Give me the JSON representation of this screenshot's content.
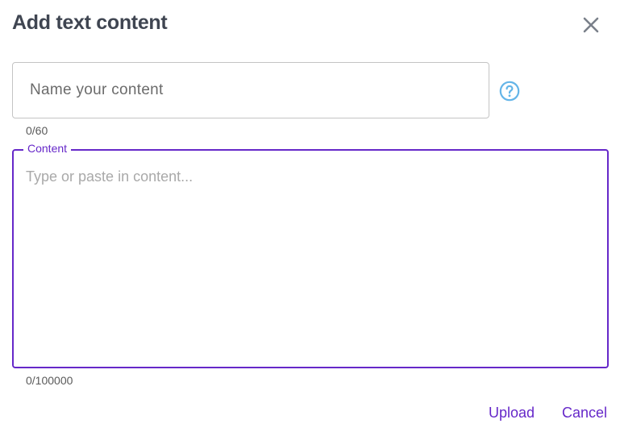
{
  "dialog": {
    "title": "Add text content",
    "close_icon": "close-icon",
    "help_icon": "help-circle-icon"
  },
  "name_field": {
    "value": "",
    "placeholder": "Name your content",
    "counter": "0/60"
  },
  "content_field": {
    "label": "Content",
    "value": "",
    "placeholder": "Type or paste in content...",
    "counter": "0/100000"
  },
  "actions": {
    "upload_label": "Upload",
    "cancel_label": "Cancel"
  },
  "colors": {
    "accent": "#6628c9",
    "title": "#3f4551",
    "help": "#64b5e8",
    "close": "#7a808a"
  }
}
